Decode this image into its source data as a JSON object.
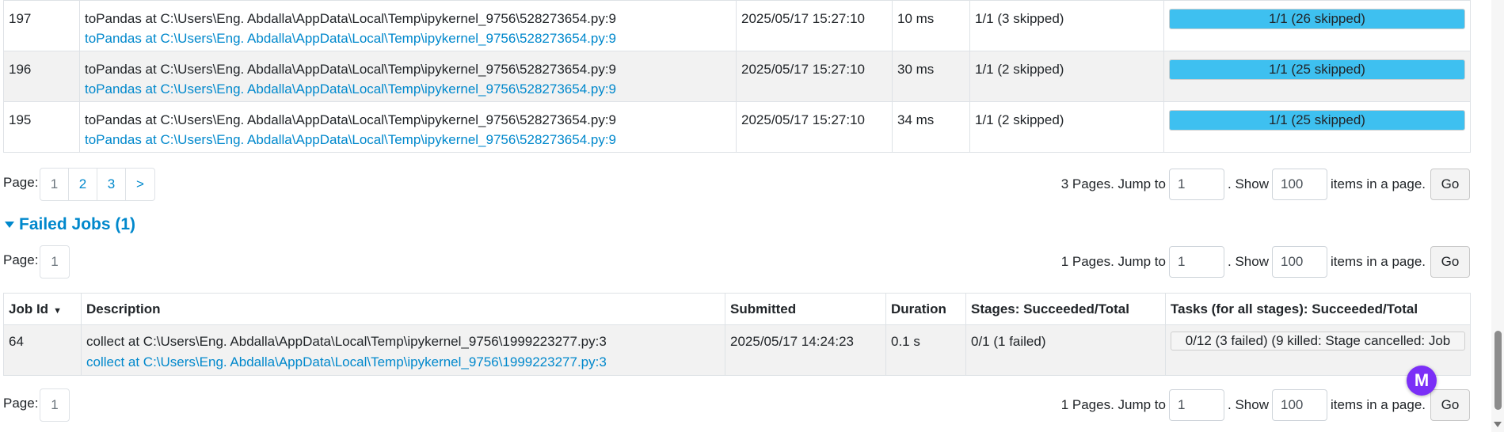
{
  "completed": {
    "rows": [
      {
        "id": "197",
        "desc_text": "toPandas at C:\\Users\\Eng. Abdalla\\AppData\\Local\\Temp\\ipykernel_9756\\528273654.py:9",
        "desc_link": "toPandas at C:\\Users\\Eng. Abdalla\\AppData\\Local\\Temp\\ipykernel_9756\\528273654.py:9",
        "submitted": "2025/05/17 15:27:10",
        "duration": "10 ms",
        "stages": "1/1 (3 skipped)",
        "tasks": "1/1 (26 skipped)"
      },
      {
        "id": "196",
        "desc_text": "toPandas at C:\\Users\\Eng. Abdalla\\AppData\\Local\\Temp\\ipykernel_9756\\528273654.py:9",
        "desc_link": "toPandas at C:\\Users\\Eng. Abdalla\\AppData\\Local\\Temp\\ipykernel_9756\\528273654.py:9",
        "submitted": "2025/05/17 15:27:10",
        "duration": "30 ms",
        "stages": "1/1 (2 skipped)",
        "tasks": "1/1 (25 skipped)"
      },
      {
        "id": "195",
        "desc_text": "toPandas at C:\\Users\\Eng. Abdalla\\AppData\\Local\\Temp\\ipykernel_9756\\528273654.py:9",
        "desc_link": "toPandas at C:\\Users\\Eng. Abdalla\\AppData\\Local\\Temp\\ipykernel_9756\\528273654.py:9",
        "submitted": "2025/05/17 15:27:10",
        "duration": "34 ms",
        "stages": "1/1 (2 skipped)",
        "tasks": "1/1 (25 skipped)"
      }
    ],
    "pager": {
      "page_label": "Page:",
      "pages": [
        "1",
        "2",
        "3",
        ">"
      ],
      "summary": "3 Pages. Jump to",
      "jump_value": "1",
      "show_label": ". Show",
      "show_value": "100",
      "items_label": "items in a page.",
      "go_label": "Go"
    }
  },
  "failed": {
    "title": "Failed Jobs (1)",
    "pager_top": {
      "page_label": "Page:",
      "pages": [
        "1"
      ],
      "summary": "1 Pages. Jump to",
      "jump_value": "1",
      "show_label": ". Show",
      "show_value": "100",
      "items_label": "items in a page.",
      "go_label": "Go"
    },
    "headers": {
      "job_id": "Job Id",
      "sort_indicator": "▼",
      "description": "Description",
      "submitted": "Submitted",
      "duration": "Duration",
      "stages": "Stages: Succeeded/Total",
      "tasks": "Tasks (for all stages): Succeeded/Total"
    },
    "rows": [
      {
        "id": "64",
        "desc_text": "collect at C:\\Users\\Eng. Abdalla\\AppData\\Local\\Temp\\ipykernel_9756\\1999223277.py:3",
        "desc_link": "collect at C:\\Users\\Eng. Abdalla\\AppData\\Local\\Temp\\ipykernel_9756\\1999223277.py:3",
        "submitted": "2025/05/17 14:24:23",
        "duration": "0.1 s",
        "stages": "0/1 (1 failed)",
        "tasks": "0/12 (3 failed) (9 killed: Stage cancelled: Job"
      }
    ],
    "pager_bottom": {
      "page_label": "Page:",
      "pages": [
        "1"
      ],
      "summary": "1 Pages. Jump to",
      "jump_value": "1",
      "show_label": ". Show",
      "show_value": "100",
      "items_label": "items in a page.",
      "go_label": "Go"
    }
  },
  "badge": {
    "letter": "M"
  },
  "progress": {
    "completed_fraction": 1.0,
    "failed_fraction": 0.0
  },
  "colors": {
    "link": "#0088cc",
    "progress_fill": "#3ec0f0",
    "badge": "#7b2ff7"
  }
}
